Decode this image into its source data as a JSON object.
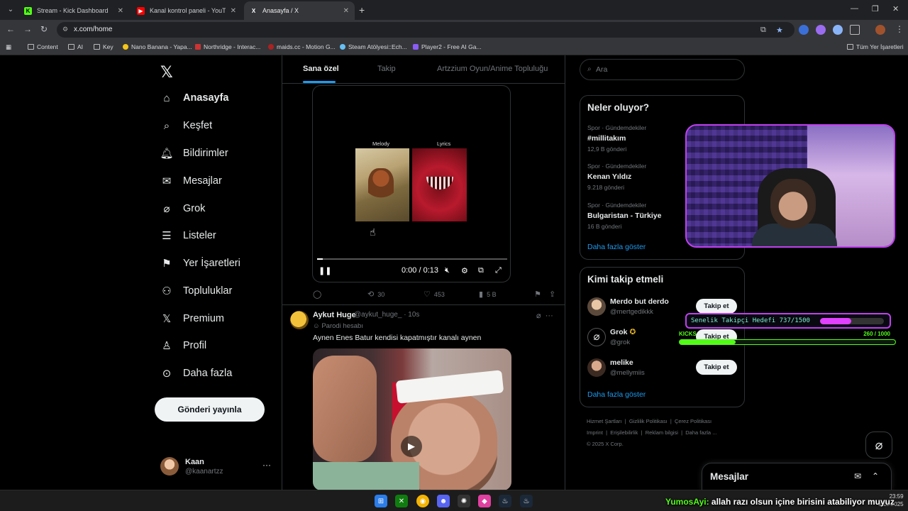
{
  "browser": {
    "tabs": [
      {
        "title": "Stream - Kick Dashboard",
        "color": "#53fc18",
        "glyph": "K"
      },
      {
        "title": "Kanal kontrol paneli - YouTube",
        "color": "#ff0000",
        "glyph": "▶"
      },
      {
        "title": "Anasayfa / X",
        "color": "#ffffff",
        "glyph": "X"
      }
    ],
    "url": "x.com/home",
    "bookmarks": [
      "Content",
      "AI",
      "Key",
      "Nano Banana - Yapa...",
      "Northridge - Interac...",
      "maids.cc - Motion G...",
      "Steam Atölyesi::Ech...",
      "Player2 - Free AI Ga..."
    ],
    "all_bookmarks": "Tüm Yer İşaretleri"
  },
  "nav": {
    "items": [
      {
        "label": "Anasayfa",
        "icon": "home-icon"
      },
      {
        "label": "Keşfet",
        "icon": "search-icon"
      },
      {
        "label": "Bildirimler",
        "icon": "bell-icon"
      },
      {
        "label": "Mesajlar",
        "icon": "mail-icon"
      },
      {
        "label": "Grok",
        "icon": "grok-icon"
      },
      {
        "label": "Listeler",
        "icon": "list-icon"
      },
      {
        "label": "Yer İşaretleri",
        "icon": "bookmark-icon"
      },
      {
        "label": "Topluluklar",
        "icon": "communities-icon"
      },
      {
        "label": "Premium",
        "icon": "x-icon"
      },
      {
        "label": "Profil",
        "icon": "profile-icon"
      },
      {
        "label": "Daha fazla",
        "icon": "more-circle-icon"
      }
    ],
    "post_button": "Gönderi yayınla",
    "account": {
      "name": "Kaan",
      "handle": "@kaanartzz"
    }
  },
  "timeline": {
    "tabs": [
      "Sana özel",
      "Takip",
      "Artzzium Oyun/Anime Topluluğu"
    ],
    "tweet1": {
      "label_left": "Melody",
      "label_right": "Lyrics",
      "time": "0:00 / 0:13",
      "progress": 0.03,
      "retweets": "30",
      "likes": "453",
      "views": "5 B"
    },
    "tweet2": {
      "name": "Aykut Huge",
      "handle": "@aykut_huge_ · 10s",
      "parody": "Parodi hesabı",
      "text": "Aynen Enes Batur kendisi kapatmıştır kanalı aynen"
    }
  },
  "sidebar": {
    "search_placeholder": "Ara",
    "trends_title": "Neler oluyor?",
    "trends": [
      {
        "context": "Spor · Gündemdekiler",
        "name": "#millitakım",
        "count": "12,9 B gönderi"
      },
      {
        "context": "Spor · Gündemdekiler",
        "name": "Kenan Yıldız",
        "count": "9.218 gönderi"
      },
      {
        "context": "Spor · Gündemdekiler",
        "name": "Bulgaristan - Türkiye",
        "count": "16 B gönderi"
      }
    ],
    "show_more": "Daha fazla göster",
    "follow_title": "Kimi takip etmeli",
    "follow": [
      {
        "name": "Merdo but derdo",
        "handle": "@mertgedikkk",
        "button": "Takip et"
      },
      {
        "name": "Grok",
        "handle": "@grok",
        "button": "Takip et"
      },
      {
        "name": "melike",
        "handle": "@mellymiis",
        "button": "Takip et"
      }
    ],
    "footer": [
      "Hizmet Şartları",
      "Gizlilik Politikası",
      "Çerez Politikası",
      "Imprint",
      "Erişilebilirlik",
      "Reklam bilgisi",
      "Daha fazla ...",
      "© 2025 X Corp."
    ]
  },
  "overlay": {
    "goal1_text": "Senelik Takipçi Hedefi 737/1500",
    "goal1_progress": 0.49,
    "goal2_label": "KICKS",
    "goal2_count": "260  / 1000",
    "goal2_progress": 0.26,
    "chat_user": "YumosAyi:",
    "chat_message": "allah razı olsun içine birisini atabiliyor muyuz"
  },
  "dm_drawer": {
    "title": "Mesajlar"
  },
  "taskbar": {
    "time": "23:59",
    "date": "0.10.2025"
  }
}
